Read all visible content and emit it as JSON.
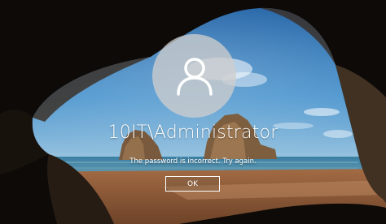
{
  "login": {
    "username": "10IT\\Administrator",
    "message": "The password is incorrect. Try again.",
    "ok_label": "OK"
  },
  "icons": {
    "avatar": "user-icon"
  },
  "colors": {
    "text": "#ffffff",
    "sky": "#3f86c4",
    "sea": "#2f6f93",
    "sand": "#8a5a38"
  }
}
